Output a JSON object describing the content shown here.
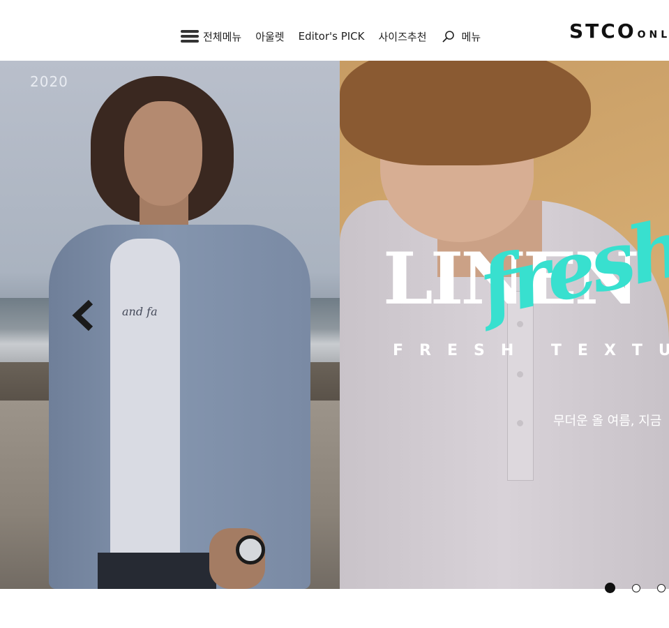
{
  "header": {
    "nav": {
      "all_menu": "전체메뉴",
      "outlet": "아울렛",
      "editors_pick": "Editor's PICK",
      "size_recommend": "사이즈추천",
      "menu": "메뉴"
    },
    "logo": {
      "main": "STCO",
      "sub": "ONL"
    }
  },
  "hero": {
    "left_slide": {
      "year": "2020",
      "tee_script": "and fa"
    },
    "right_slide": {
      "title": "LINEN",
      "script": "fresh",
      "tagline": "FRESH TEXTUR",
      "subcopy": "무더운 올 여름, 지금"
    },
    "prev_icon": "chevron-left-icon",
    "pagination": {
      "count": 3,
      "active_index": 0
    }
  },
  "colors": {
    "accent_script": "#38e0cf",
    "overlay_text": "#ffffff",
    "header_text": "#222222"
  }
}
